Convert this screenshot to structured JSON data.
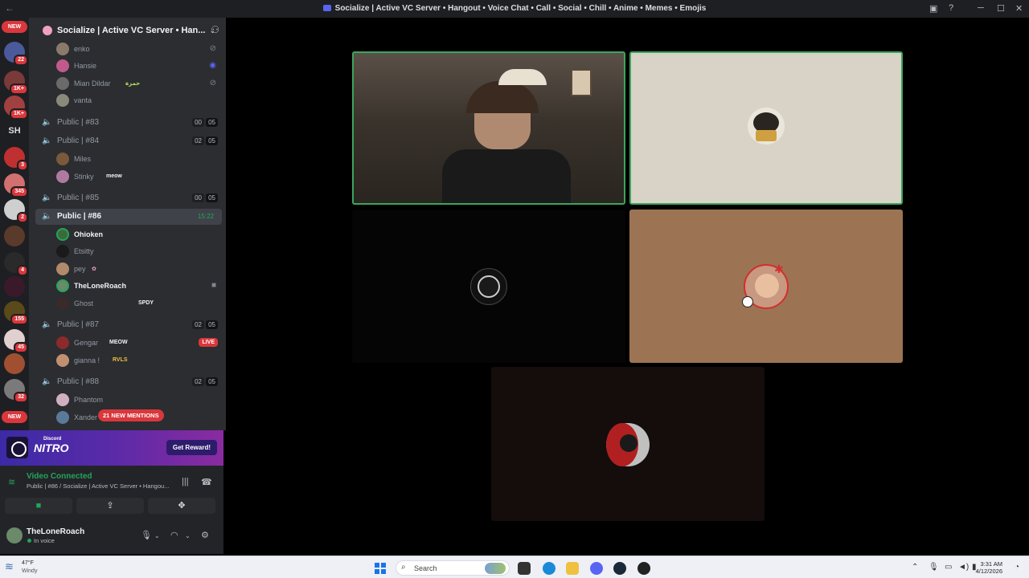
{
  "window": {
    "title": "Socialize | Active VC Server • Hangout • Voice Chat • Call • Social • Chill • Anime • Memes • Emojis"
  },
  "rail": {
    "new_label_top": "NEW",
    "new_label_bottom": "NEW",
    "text_server": "SH",
    "badges": [
      "22",
      "1K+",
      "1K+",
      "3",
      "345",
      "2",
      "4",
      "155",
      "45",
      "32"
    ]
  },
  "server": {
    "name": "Socialize | Active VC Server • Han..."
  },
  "channels": [
    {
      "kind": "member",
      "name": "enko"
    },
    {
      "kind": "member",
      "name": "Hansie"
    },
    {
      "kind": "member",
      "name": "Mian Dildar",
      "tag": "حمزة"
    },
    {
      "kind": "member",
      "name": "vanta"
    },
    {
      "kind": "channel",
      "name": "Public | #83",
      "count_a": "00",
      "count_b": "05"
    },
    {
      "kind": "channel",
      "name": "Public | #84",
      "count_a": "02",
      "count_b": "05"
    },
    {
      "kind": "member",
      "name": "Miles"
    },
    {
      "kind": "member",
      "name": "Stinky",
      "tag": "meow"
    },
    {
      "kind": "channel",
      "name": "Public | #85",
      "count_a": "00",
      "count_b": "05"
    },
    {
      "kind": "channel",
      "name": "Public | #86",
      "timer": "15:22"
    },
    {
      "kind": "member",
      "name": "Ohioken"
    },
    {
      "kind": "member",
      "name": "Etsitty"
    },
    {
      "kind": "member",
      "name": "pey"
    },
    {
      "kind": "member",
      "name": "TheLoneRoach"
    },
    {
      "kind": "member",
      "name": "Ghost",
      "tag": "SPDY"
    },
    {
      "kind": "channel",
      "name": "Public | #87",
      "count_a": "02",
      "count_b": "05"
    },
    {
      "kind": "member",
      "name": "Gengar",
      "tag": "MEOW",
      "live": "LIVE"
    },
    {
      "kind": "member",
      "name": "gianna !",
      "tag": "RVLS"
    },
    {
      "kind": "channel",
      "name": "Public | #88",
      "count_a": "02",
      "count_b": "05"
    },
    {
      "kind": "member",
      "name": "Phantom"
    },
    {
      "kind": "member",
      "name": "Xander"
    }
  ],
  "mentions_pill": "21 NEW MENTIONS",
  "nitro": {
    "small": "Discord",
    "big": "NITRO",
    "cta": "Get Reward!"
  },
  "voice": {
    "status": "Video Connected",
    "sub": "Public | #86 / Socialize | Active VC Server • Hangou..."
  },
  "user": {
    "name": "TheLoneRoach",
    "status": "In voice"
  },
  "taskbar": {
    "temp": "47°F",
    "condition": "Windy",
    "search_placeholder": "Search",
    "time": "3:31 AM",
    "date": "4/12/2026"
  },
  "colors": {
    "accent_green": "#23a55a",
    "speaking_border": "#3ba55d",
    "alert_red": "#da373c",
    "blurple": "#5865f2"
  }
}
